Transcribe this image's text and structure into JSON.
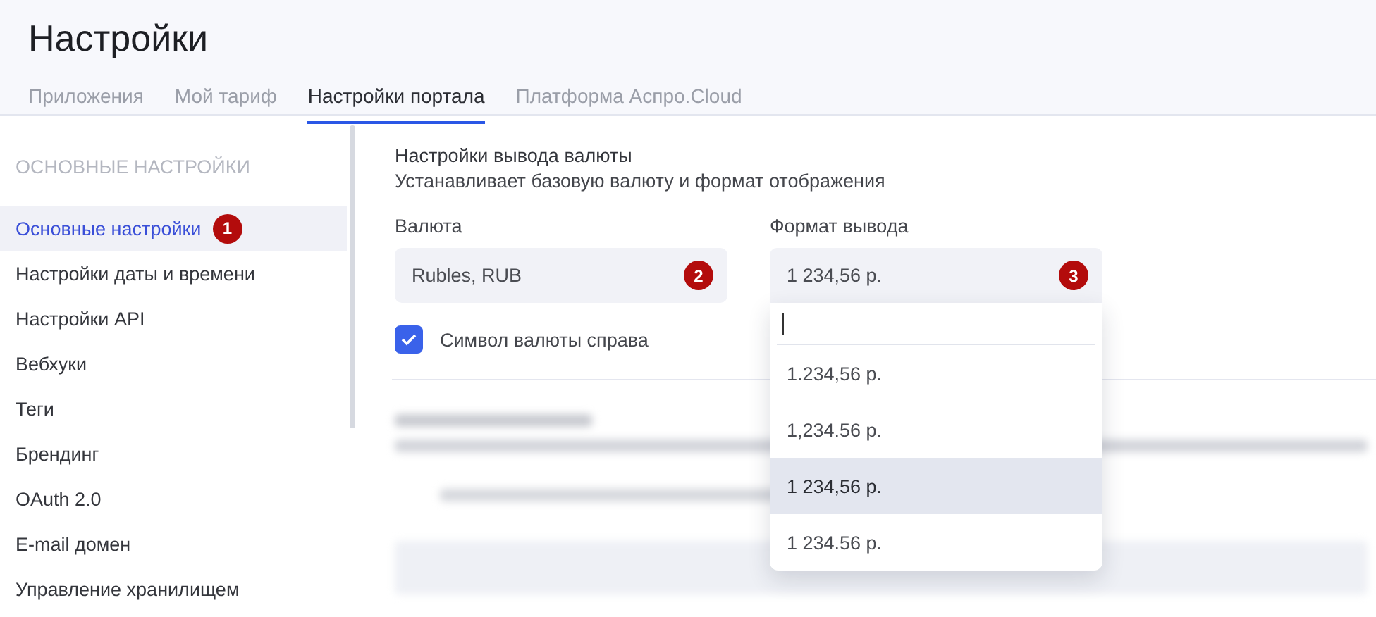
{
  "page_title": "Настройки",
  "tabs": [
    {
      "label": "Приложения",
      "selected": false
    },
    {
      "label": "Мой тариф",
      "selected": false
    },
    {
      "label": "Настройки портала",
      "selected": true
    },
    {
      "label": "Платформа Аспро.Cloud",
      "selected": false
    }
  ],
  "sidebar": {
    "heading": "ОСНОВНЫЕ НАСТРОЙКИ",
    "items": [
      {
        "label": "Основные настройки",
        "selected": true,
        "badge": "1"
      },
      {
        "label": "Настройки даты и времени",
        "selected": false
      },
      {
        "label": "Настройки API",
        "selected": false
      },
      {
        "label": "Вебхуки",
        "selected": false
      },
      {
        "label": "Теги",
        "selected": false
      },
      {
        "label": "Брендинг",
        "selected": false
      },
      {
        "label": "OAuth 2.0",
        "selected": false
      },
      {
        "label": "E-mail домен",
        "selected": false
      },
      {
        "label": "Управление хранилищем",
        "selected": false
      }
    ]
  },
  "currency_section": {
    "title": "Настройки вывода валюты",
    "description": "Устанавливает базовую валюту и формат отображения",
    "currency_field": {
      "label": "Валюта",
      "value": "Rubles, RUB",
      "badge": "2"
    },
    "format_field": {
      "label": "Формат вывода",
      "value": "1 234,56 р.",
      "badge": "3"
    },
    "symbol_right": {
      "label": "Символ валюты справа",
      "checked": true
    }
  },
  "format_dropdown": {
    "options": [
      {
        "label": "1.234,56 р.",
        "selected": false
      },
      {
        "label": "1,234.56 р.",
        "selected": false
      },
      {
        "label": "1 234,56 р.",
        "selected": true
      },
      {
        "label": "1 234.56 р.",
        "selected": false
      }
    ]
  }
}
